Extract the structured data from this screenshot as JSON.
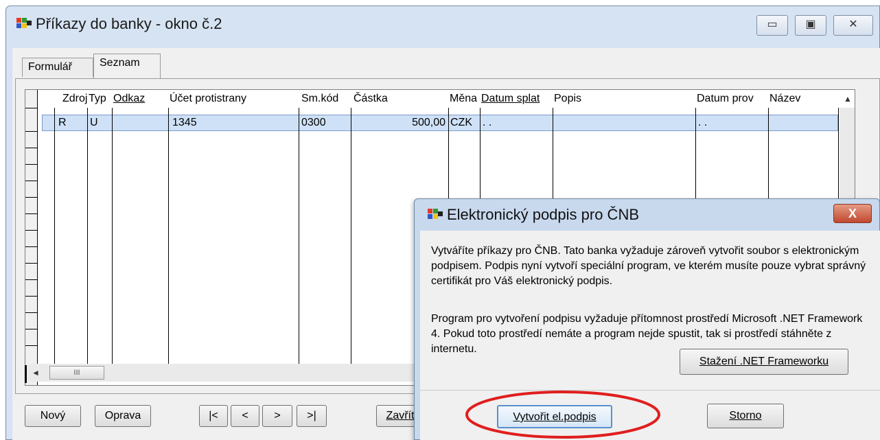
{
  "window": {
    "title": "Příkazy do banky - okno č.2",
    "minimize_glyph": "▭",
    "restore_glyph": "▣",
    "close_glyph": "✕"
  },
  "tabs": [
    {
      "label": "Formulář",
      "active": false
    },
    {
      "label": "Seznam",
      "active": true
    }
  ],
  "grid": {
    "columns": [
      "Zdroj",
      "Typ",
      "Odkaz",
      "Účet protistrany",
      "Sm.kód",
      "Částka",
      "Měna",
      "Datum splat",
      "Popis",
      "Datum prov",
      "Název"
    ],
    "rows": [
      {
        "zdroj": "R",
        "typ": "U",
        "odkaz": "",
        "ucet": "1345",
        "smkod": "0300",
        "castka": "500,00",
        "mena": "CZK",
        "datum_splat": ". .",
        "popis": "",
        "datum_prov": ". .",
        "nazev": ""
      }
    ],
    "scroll_up_glyph": "▲",
    "scroll_left_glyph": "◄",
    "scroll_thumb_glyph": "III"
  },
  "buttons": {
    "novy": "Nový",
    "oprava": "Oprava",
    "first": "|<",
    "prev": "<",
    "next": ">",
    "last": ">|",
    "zavrit": "Zavřít"
  },
  "dialog": {
    "title": "Elektronický podpis pro ČNB",
    "close_glyph": "X",
    "paragraph1": "Vytváříte příkazy pro ČNB. Tato banka vyžaduje zároveň vytvořit soubor s elektronickým podpisem. Podpis nyní vytvoří speciální program, ve kterém musíte pouze vybrat správný certifikát pro Váš elektronický podpis.",
    "paragraph2": "Program pro vytvoření podpisu vyžaduje přítomnost prostředí Microsoft .NET Framework 4. Pokud toto prostředí nemáte a program nejde spustit, tak si prostředí stáhněte z internetu.",
    "download_button": "Stažení .NET Frameworku",
    "create_button": "Vytvořit el.podpis",
    "cancel_button": "Storno",
    "highlight_color": "#e01e1e"
  }
}
